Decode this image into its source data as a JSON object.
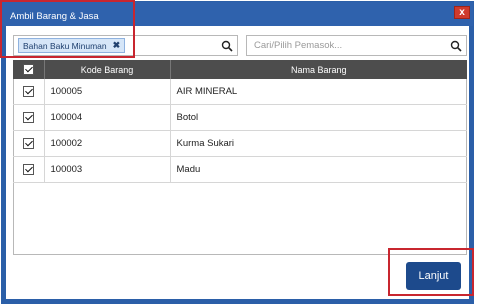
{
  "window": {
    "title": "Ambil Barang & Jasa",
    "close_label": "x"
  },
  "filter": {
    "chip_label": "Bahan Baku Minuman",
    "chip_remove": "✖"
  },
  "supplier": {
    "placeholder": "Cari/Pilih Pemasok..."
  },
  "table": {
    "columns": [
      "",
      "Kode Barang",
      "Nama Barang"
    ],
    "rows": [
      {
        "checked": true,
        "kode": "100005",
        "nama": "AIR MINERAL"
      },
      {
        "checked": true,
        "kode": "100004",
        "nama": "Botol"
      },
      {
        "checked": true,
        "kode": "100002",
        "nama": "Kurma Sukari"
      },
      {
        "checked": true,
        "kode": "100003",
        "nama": "Madu"
      }
    ]
  },
  "actions": {
    "next_label": "Lanjut"
  },
  "colors": {
    "titlebar": "#2f62ad",
    "primary_button": "#1d4a8c",
    "highlight": "#c8262f",
    "header": "#4d4d4d"
  }
}
